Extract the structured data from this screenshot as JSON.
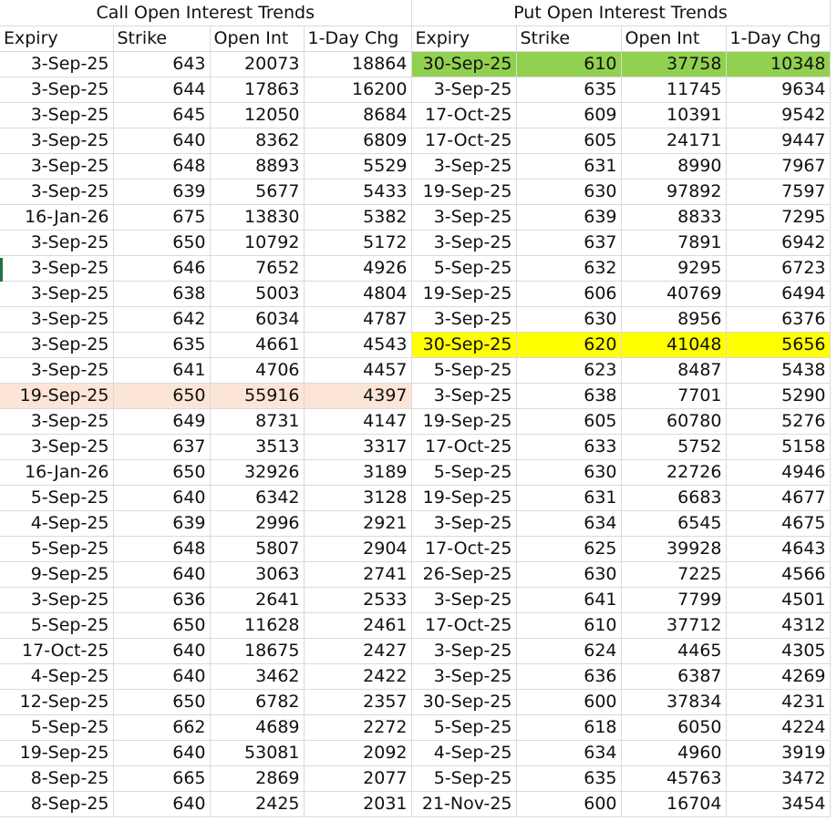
{
  "call_title": "Call Open Interest Trends",
  "put_title": "Put Open Interest Trends",
  "headers": [
    "Expiry",
    "Strike",
    "Open Int",
    "1-Day Chg"
  ],
  "call_rows": [
    [
      "3-Sep-25",
      "643",
      "20073",
      "18864"
    ],
    [
      "3-Sep-25",
      "644",
      "17863",
      "16200"
    ],
    [
      "3-Sep-25",
      "645",
      "12050",
      "8684"
    ],
    [
      "3-Sep-25",
      "640",
      "8362",
      "6809"
    ],
    [
      "3-Sep-25",
      "648",
      "8893",
      "5529"
    ],
    [
      "3-Sep-25",
      "639",
      "5677",
      "5433"
    ],
    [
      "16-Jan-26",
      "675",
      "13830",
      "5382"
    ],
    [
      "3-Sep-25",
      "650",
      "10792",
      "5172"
    ],
    [
      "3-Sep-25",
      "646",
      "7652",
      "4926"
    ],
    [
      "3-Sep-25",
      "638",
      "5003",
      "4804"
    ],
    [
      "3-Sep-25",
      "642",
      "6034",
      "4787"
    ],
    [
      "3-Sep-25",
      "635",
      "4661",
      "4543"
    ],
    [
      "3-Sep-25",
      "641",
      "4706",
      "4457"
    ],
    [
      "19-Sep-25",
      "650",
      "55916",
      "4397"
    ],
    [
      "3-Sep-25",
      "649",
      "8731",
      "4147"
    ],
    [
      "3-Sep-25",
      "637",
      "3513",
      "3317"
    ],
    [
      "16-Jan-26",
      "650",
      "32926",
      "3189"
    ],
    [
      "5-Sep-25",
      "640",
      "6342",
      "3128"
    ],
    [
      "4-Sep-25",
      "639",
      "2996",
      "2921"
    ],
    [
      "5-Sep-25",
      "648",
      "5807",
      "2904"
    ],
    [
      "9-Sep-25",
      "640",
      "3063",
      "2741"
    ],
    [
      "3-Sep-25",
      "636",
      "2641",
      "2533"
    ],
    [
      "5-Sep-25",
      "650",
      "11628",
      "2461"
    ],
    [
      "17-Oct-25",
      "640",
      "18675",
      "2427"
    ],
    [
      "4-Sep-25",
      "640",
      "3462",
      "2422"
    ],
    [
      "12-Sep-25",
      "650",
      "6782",
      "2357"
    ],
    [
      "5-Sep-25",
      "662",
      "4689",
      "2272"
    ],
    [
      "19-Sep-25",
      "640",
      "53081",
      "2092"
    ],
    [
      "8-Sep-25",
      "665",
      "2869",
      "2077"
    ],
    [
      "8-Sep-25",
      "640",
      "2425",
      "2031"
    ]
  ],
  "put_rows": [
    [
      "30-Sep-25",
      "610",
      "37758",
      "10348"
    ],
    [
      "3-Sep-25",
      "635",
      "11745",
      "9634"
    ],
    [
      "17-Oct-25",
      "609",
      "10391",
      "9542"
    ],
    [
      "17-Oct-25",
      "605",
      "24171",
      "9447"
    ],
    [
      "3-Sep-25",
      "631",
      "8990",
      "7967"
    ],
    [
      "19-Sep-25",
      "630",
      "97892",
      "7597"
    ],
    [
      "3-Sep-25",
      "639",
      "8833",
      "7295"
    ],
    [
      "3-Sep-25",
      "637",
      "7891",
      "6942"
    ],
    [
      "5-Sep-25",
      "632",
      "9295",
      "6723"
    ],
    [
      "19-Sep-25",
      "606",
      "40769",
      "6494"
    ],
    [
      "3-Sep-25",
      "630",
      "8956",
      "6376"
    ],
    [
      "30-Sep-25",
      "620",
      "41048",
      "5656"
    ],
    [
      "5-Sep-25",
      "623",
      "8487",
      "5438"
    ],
    [
      "3-Sep-25",
      "638",
      "7701",
      "5290"
    ],
    [
      "19-Sep-25",
      "605",
      "60780",
      "5276"
    ],
    [
      "17-Oct-25",
      "633",
      "5752",
      "5158"
    ],
    [
      "5-Sep-25",
      "630",
      "22726",
      "4946"
    ],
    [
      "19-Sep-25",
      "631",
      "6683",
      "4677"
    ],
    [
      "3-Sep-25",
      "634",
      "6545",
      "4675"
    ],
    [
      "17-Oct-25",
      "625",
      "39928",
      "4643"
    ],
    [
      "26-Sep-25",
      "630",
      "7225",
      "4566"
    ],
    [
      "3-Sep-25",
      "641",
      "7799",
      "4501"
    ],
    [
      "17-Oct-25",
      "610",
      "37712",
      "4312"
    ],
    [
      "3-Sep-25",
      "624",
      "4465",
      "4305"
    ],
    [
      "3-Sep-25",
      "636",
      "6387",
      "4269"
    ],
    [
      "30-Sep-25",
      "600",
      "37834",
      "4231"
    ],
    [
      "5-Sep-25",
      "618",
      "6050",
      "4224"
    ],
    [
      "4-Sep-25",
      "634",
      "4960",
      "3919"
    ],
    [
      "5-Sep-25",
      "635",
      "45763",
      "3472"
    ],
    [
      "21-Nov-25",
      "600",
      "16704",
      "3454"
    ]
  ],
  "highlight_colors": {
    "green": "#92d050",
    "yellow": "#ffff00",
    "peach": "#fce4d6"
  }
}
